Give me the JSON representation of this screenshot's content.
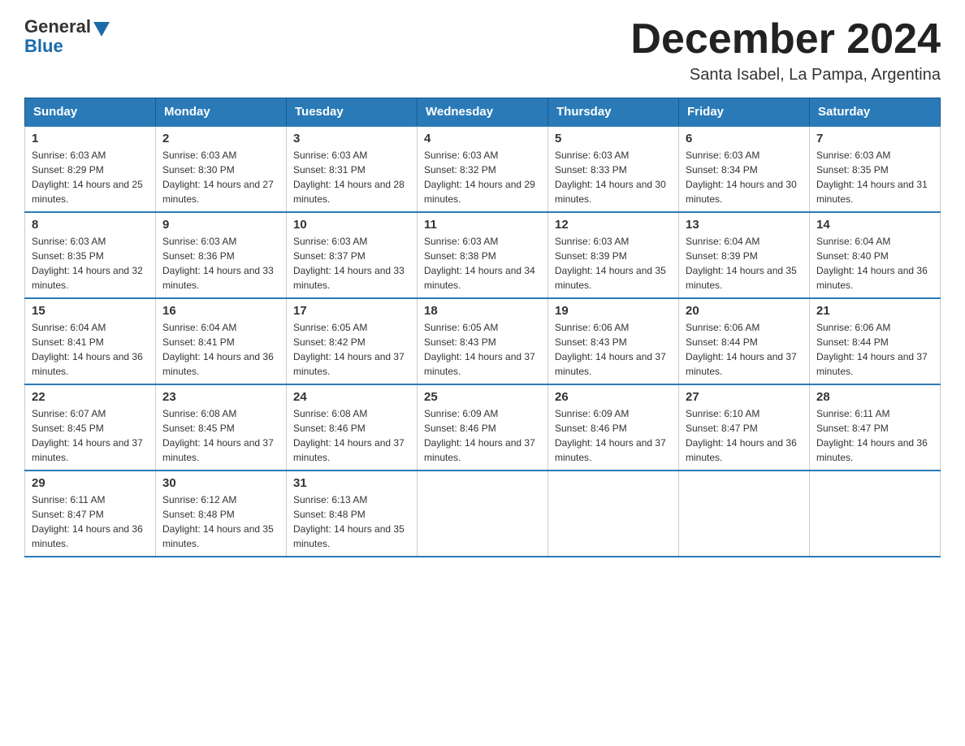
{
  "header": {
    "logo_text_general": "General",
    "logo_text_blue": "Blue",
    "month_title": "December 2024",
    "subtitle": "Santa Isabel, La Pampa, Argentina"
  },
  "calendar": {
    "days_of_week": [
      "Sunday",
      "Monday",
      "Tuesday",
      "Wednesday",
      "Thursday",
      "Friday",
      "Saturday"
    ],
    "weeks": [
      [
        {
          "day": "1",
          "sunrise": "6:03 AM",
          "sunset": "8:29 PM",
          "daylight": "14 hours and 25 minutes."
        },
        {
          "day": "2",
          "sunrise": "6:03 AM",
          "sunset": "8:30 PM",
          "daylight": "14 hours and 27 minutes."
        },
        {
          "day": "3",
          "sunrise": "6:03 AM",
          "sunset": "8:31 PM",
          "daylight": "14 hours and 28 minutes."
        },
        {
          "day": "4",
          "sunrise": "6:03 AM",
          "sunset": "8:32 PM",
          "daylight": "14 hours and 29 minutes."
        },
        {
          "day": "5",
          "sunrise": "6:03 AM",
          "sunset": "8:33 PM",
          "daylight": "14 hours and 30 minutes."
        },
        {
          "day": "6",
          "sunrise": "6:03 AM",
          "sunset": "8:34 PM",
          "daylight": "14 hours and 30 minutes."
        },
        {
          "day": "7",
          "sunrise": "6:03 AM",
          "sunset": "8:35 PM",
          "daylight": "14 hours and 31 minutes."
        }
      ],
      [
        {
          "day": "8",
          "sunrise": "6:03 AM",
          "sunset": "8:35 PM",
          "daylight": "14 hours and 32 minutes."
        },
        {
          "day": "9",
          "sunrise": "6:03 AM",
          "sunset": "8:36 PM",
          "daylight": "14 hours and 33 minutes."
        },
        {
          "day": "10",
          "sunrise": "6:03 AM",
          "sunset": "8:37 PM",
          "daylight": "14 hours and 33 minutes."
        },
        {
          "day": "11",
          "sunrise": "6:03 AM",
          "sunset": "8:38 PM",
          "daylight": "14 hours and 34 minutes."
        },
        {
          "day": "12",
          "sunrise": "6:03 AM",
          "sunset": "8:39 PM",
          "daylight": "14 hours and 35 minutes."
        },
        {
          "day": "13",
          "sunrise": "6:04 AM",
          "sunset": "8:39 PM",
          "daylight": "14 hours and 35 minutes."
        },
        {
          "day": "14",
          "sunrise": "6:04 AM",
          "sunset": "8:40 PM",
          "daylight": "14 hours and 36 minutes."
        }
      ],
      [
        {
          "day": "15",
          "sunrise": "6:04 AM",
          "sunset": "8:41 PM",
          "daylight": "14 hours and 36 minutes."
        },
        {
          "day": "16",
          "sunrise": "6:04 AM",
          "sunset": "8:41 PM",
          "daylight": "14 hours and 36 minutes."
        },
        {
          "day": "17",
          "sunrise": "6:05 AM",
          "sunset": "8:42 PM",
          "daylight": "14 hours and 37 minutes."
        },
        {
          "day": "18",
          "sunrise": "6:05 AM",
          "sunset": "8:43 PM",
          "daylight": "14 hours and 37 minutes."
        },
        {
          "day": "19",
          "sunrise": "6:06 AM",
          "sunset": "8:43 PM",
          "daylight": "14 hours and 37 minutes."
        },
        {
          "day": "20",
          "sunrise": "6:06 AM",
          "sunset": "8:44 PM",
          "daylight": "14 hours and 37 minutes."
        },
        {
          "day": "21",
          "sunrise": "6:06 AM",
          "sunset": "8:44 PM",
          "daylight": "14 hours and 37 minutes."
        }
      ],
      [
        {
          "day": "22",
          "sunrise": "6:07 AM",
          "sunset": "8:45 PM",
          "daylight": "14 hours and 37 minutes."
        },
        {
          "day": "23",
          "sunrise": "6:08 AM",
          "sunset": "8:45 PM",
          "daylight": "14 hours and 37 minutes."
        },
        {
          "day": "24",
          "sunrise": "6:08 AM",
          "sunset": "8:46 PM",
          "daylight": "14 hours and 37 minutes."
        },
        {
          "day": "25",
          "sunrise": "6:09 AM",
          "sunset": "8:46 PM",
          "daylight": "14 hours and 37 minutes."
        },
        {
          "day": "26",
          "sunrise": "6:09 AM",
          "sunset": "8:46 PM",
          "daylight": "14 hours and 37 minutes."
        },
        {
          "day": "27",
          "sunrise": "6:10 AM",
          "sunset": "8:47 PM",
          "daylight": "14 hours and 36 minutes."
        },
        {
          "day": "28",
          "sunrise": "6:11 AM",
          "sunset": "8:47 PM",
          "daylight": "14 hours and 36 minutes."
        }
      ],
      [
        {
          "day": "29",
          "sunrise": "6:11 AM",
          "sunset": "8:47 PM",
          "daylight": "14 hours and 36 minutes."
        },
        {
          "day": "30",
          "sunrise": "6:12 AM",
          "sunset": "8:48 PM",
          "daylight": "14 hours and 35 minutes."
        },
        {
          "day": "31",
          "sunrise": "6:13 AM",
          "sunset": "8:48 PM",
          "daylight": "14 hours and 35 minutes."
        },
        null,
        null,
        null,
        null
      ]
    ]
  }
}
